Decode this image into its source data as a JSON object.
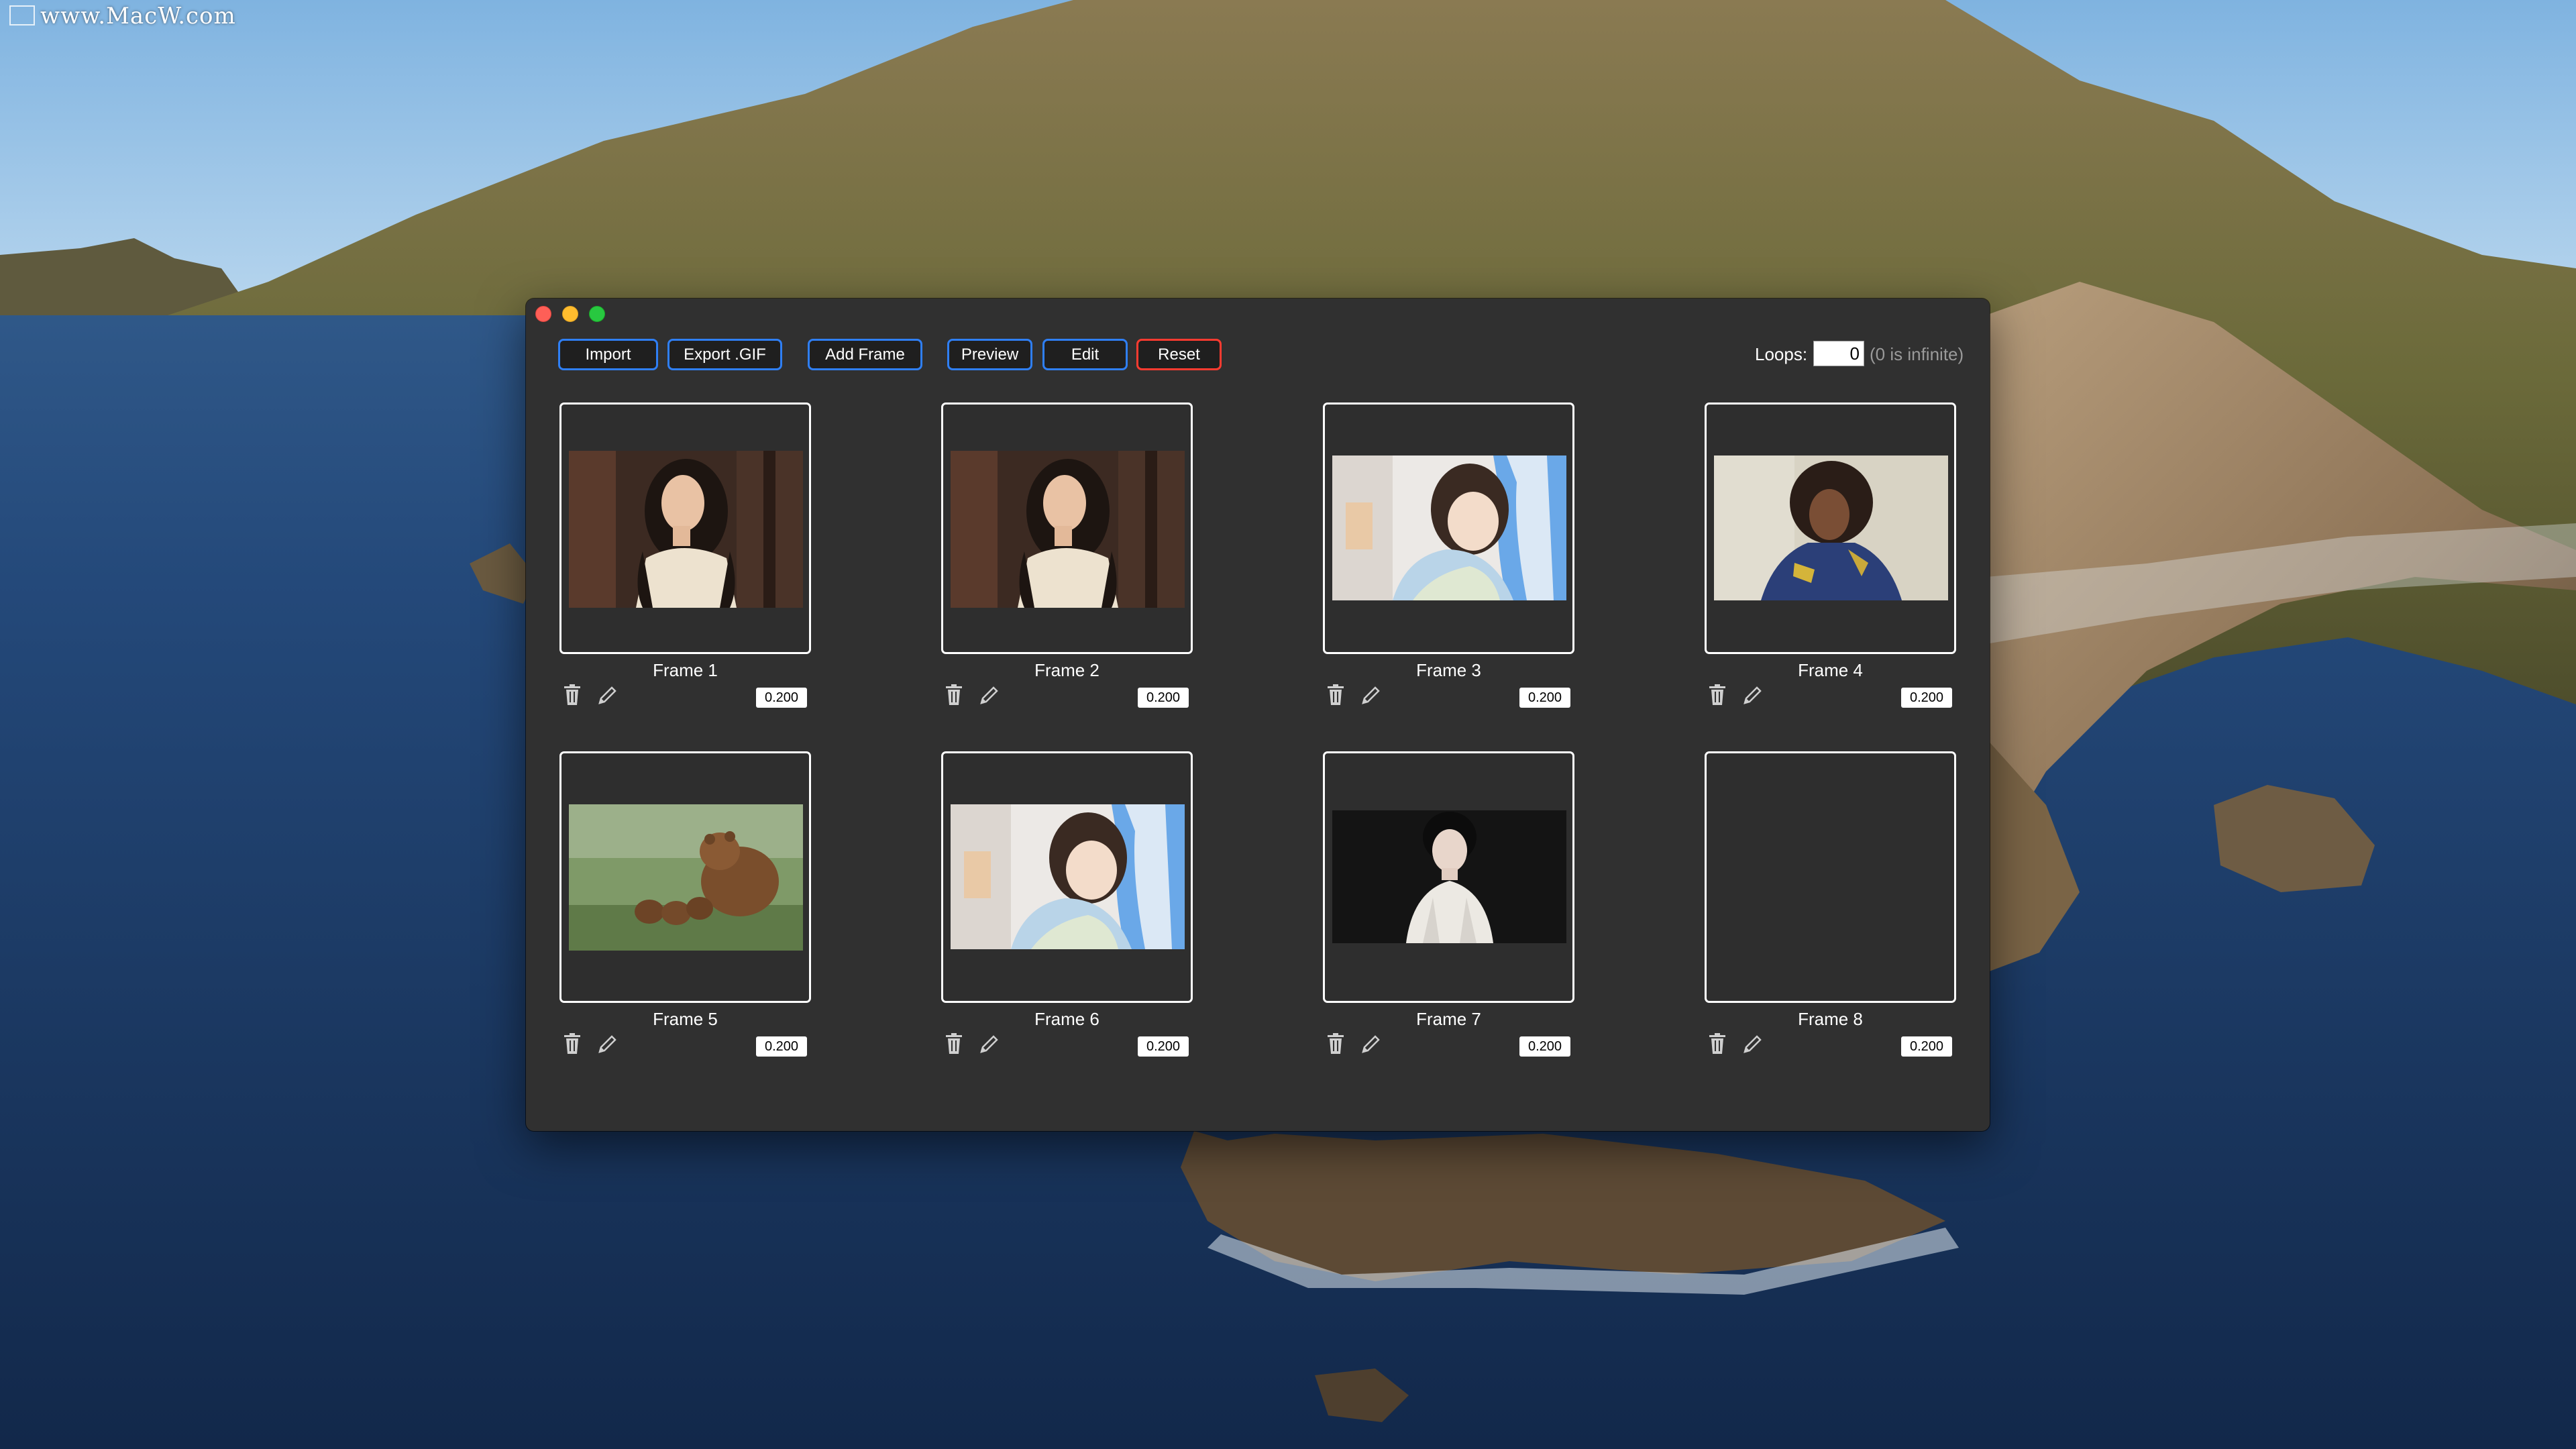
{
  "watermark": {
    "text": "www.MacW.com"
  },
  "toolbar": {
    "import_label": "Import",
    "export_label": "Export .GIF",
    "add_frame_label": "Add Frame",
    "preview_label": "Preview",
    "edit_label": "Edit",
    "reset_label": "Reset",
    "accent_color": "#2f7ff5",
    "reset_color": "#ff3b30"
  },
  "loops": {
    "label": "Loops:",
    "value": "0",
    "hint": "(0 is infinite)"
  },
  "frames": [
    {
      "name": "Frame 1",
      "delay": "0.200",
      "thumbnail": "woman-dark-hair-cream-dress"
    },
    {
      "name": "Frame 2",
      "delay": "0.200",
      "thumbnail": "woman-dark-hair-cream-dress"
    },
    {
      "name": "Frame 3",
      "delay": "0.200",
      "thumbnail": "woman-blue-towel"
    },
    {
      "name": "Frame 4",
      "delay": "0.200",
      "thumbnail": "woman-curly-hair-denim"
    },
    {
      "name": "Frame 5",
      "delay": "0.200",
      "thumbnail": "bear-with-cubs"
    },
    {
      "name": "Frame 6",
      "delay": "0.200",
      "thumbnail": "woman-blue-towel"
    },
    {
      "name": "Frame 7",
      "delay": "0.200",
      "thumbnail": "woman-dark-background"
    },
    {
      "name": "Frame 8",
      "delay": "0.200",
      "thumbnail": ""
    }
  ]
}
